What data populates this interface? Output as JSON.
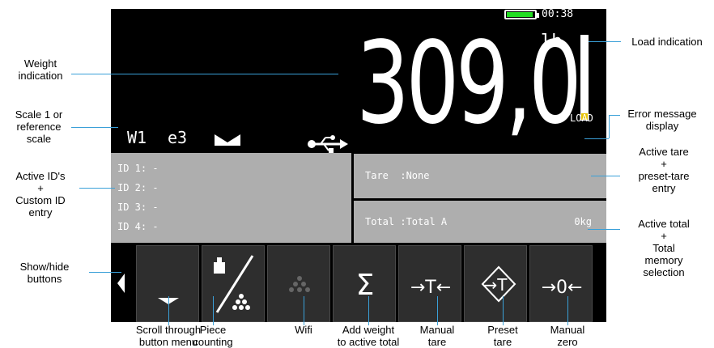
{
  "status": {
    "clock": "00:38",
    "battery_level": 0.9
  },
  "display": {
    "weight": "309,0",
    "unit": "lb",
    "load_text": "LOAD",
    "load_level": 0.08,
    "scale_id": "W1",
    "accuracy_class": "e3"
  },
  "ids": [
    "ID 1: -",
    "ID 2: -",
    "ID 3: -",
    "ID 4: -"
  ],
  "tare": {
    "text": "Tare  :None"
  },
  "total": {
    "text": "Total :Total A",
    "value": "0kg"
  },
  "buttons": [
    {
      "name": "show-hide",
      "icon": "triangle-left-icon"
    },
    {
      "name": "scroll",
      "icon": "triangle-down-icon"
    },
    {
      "name": "piece-counting",
      "icon": "piece-counting-icon"
    },
    {
      "name": "wifi",
      "icon": "dots-icon"
    },
    {
      "name": "add-weight",
      "icon": "sigma-icon",
      "glyph": "Σ"
    },
    {
      "name": "manual-tare",
      "icon": "tare-icon",
      "glyph": "→T←"
    },
    {
      "name": "preset-tare",
      "icon": "preset-tare-icon",
      "glyph": "→T"
    },
    {
      "name": "manual-zero",
      "icon": "zero-icon",
      "glyph": "→0←"
    }
  ],
  "callouts": {
    "weight_indication": "Weight\nindication",
    "scale_ref": "Scale 1 or\nreference\nscale",
    "active_ids": "Active ID's\n+\nCustom ID\nentry",
    "show_hide": "Show/hide\nbuttons",
    "load_indication": "Load indication",
    "error_message": "Error message\ndisplay",
    "active_tare": "Active tare\n+\npreset-tare\nentry",
    "active_total": "Active total\n+\nTotal\nmemory\nselection",
    "scroll": "Scroll through\nbutton menu",
    "piece_counting": "Piece\ncounting",
    "wifi": "Wifi",
    "add_weight": "Add weight\nto active total",
    "manual_tare": "Manual\ntare",
    "preset_tare": "Preset\ntare",
    "manual_zero": "Manual\nzero"
  },
  "colors": {
    "accent_line": "#3aa0d8",
    "battery": "#22dd22",
    "load": "#e6c200"
  }
}
